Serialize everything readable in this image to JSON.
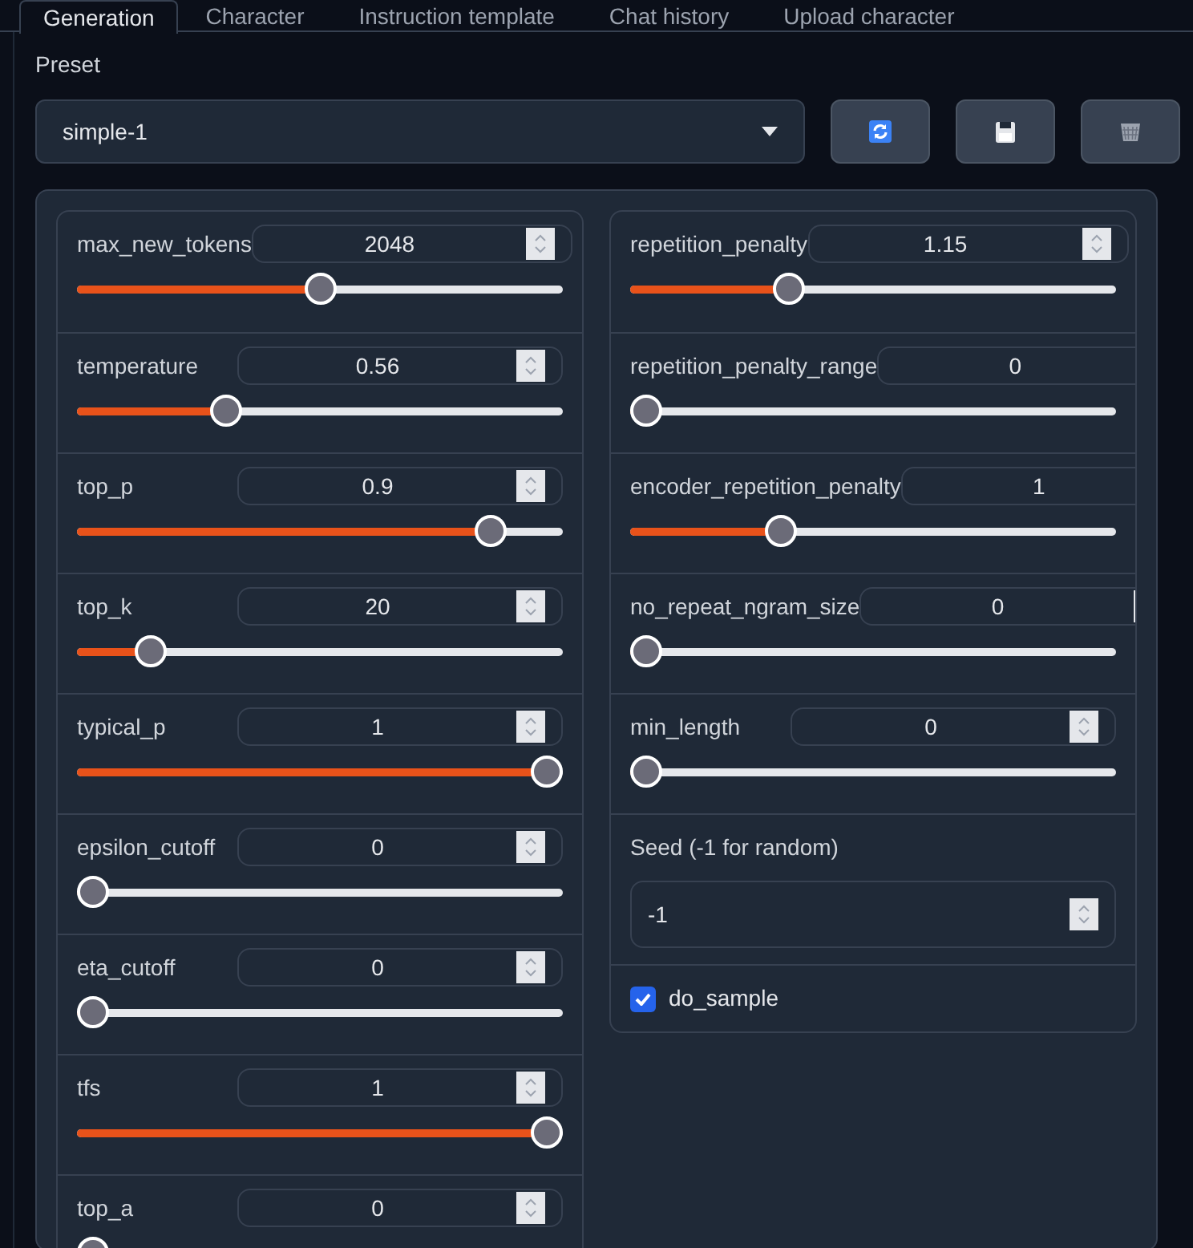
{
  "tabs": [
    {
      "label": "Generation",
      "selected": true
    },
    {
      "label": "Character",
      "selected": false
    },
    {
      "label": "Instruction template",
      "selected": false
    },
    {
      "label": "Chat history",
      "selected": false
    },
    {
      "label": "Upload character",
      "selected": false
    }
  ],
  "preset": {
    "label": "Preset",
    "value": "simple-1"
  },
  "left_sliders": [
    {
      "label": "max_new_tokens",
      "value": "2048",
      "level": 0.5
    },
    {
      "label": "temperature",
      "value": "0.56",
      "level": 0.295
    },
    {
      "label": "top_p",
      "value": "0.9",
      "level": 0.877
    },
    {
      "label": "top_k",
      "value": "20",
      "level": 0.126
    },
    {
      "label": "typical_p",
      "value": "1",
      "level": 1
    },
    {
      "label": "epsilon_cutoff",
      "value": "0",
      "level": 0
    },
    {
      "label": "eta_cutoff",
      "value": "0",
      "level": 0
    },
    {
      "label": "tfs",
      "value": "1",
      "level": 1
    },
    {
      "label": "top_a",
      "value": "0",
      "level": 0
    }
  ],
  "right_sliders": [
    {
      "label": "repetition_penalty",
      "value": "1.15",
      "level": 0.313
    },
    {
      "label": "repetition_penalty_range",
      "value": "0",
      "level": 0
    },
    {
      "label": "encoder_repetition_penalty",
      "value": "1",
      "level": 0.297
    },
    {
      "label": "no_repeat_ngram_size",
      "value": "0",
      "level": 0
    },
    {
      "label": "min_length",
      "value": "0",
      "level": 0
    }
  ],
  "seed": {
    "label": "Seed (-1 for random)",
    "value": "-1"
  },
  "do_sample": {
    "label": "do_sample",
    "checked": true
  }
}
